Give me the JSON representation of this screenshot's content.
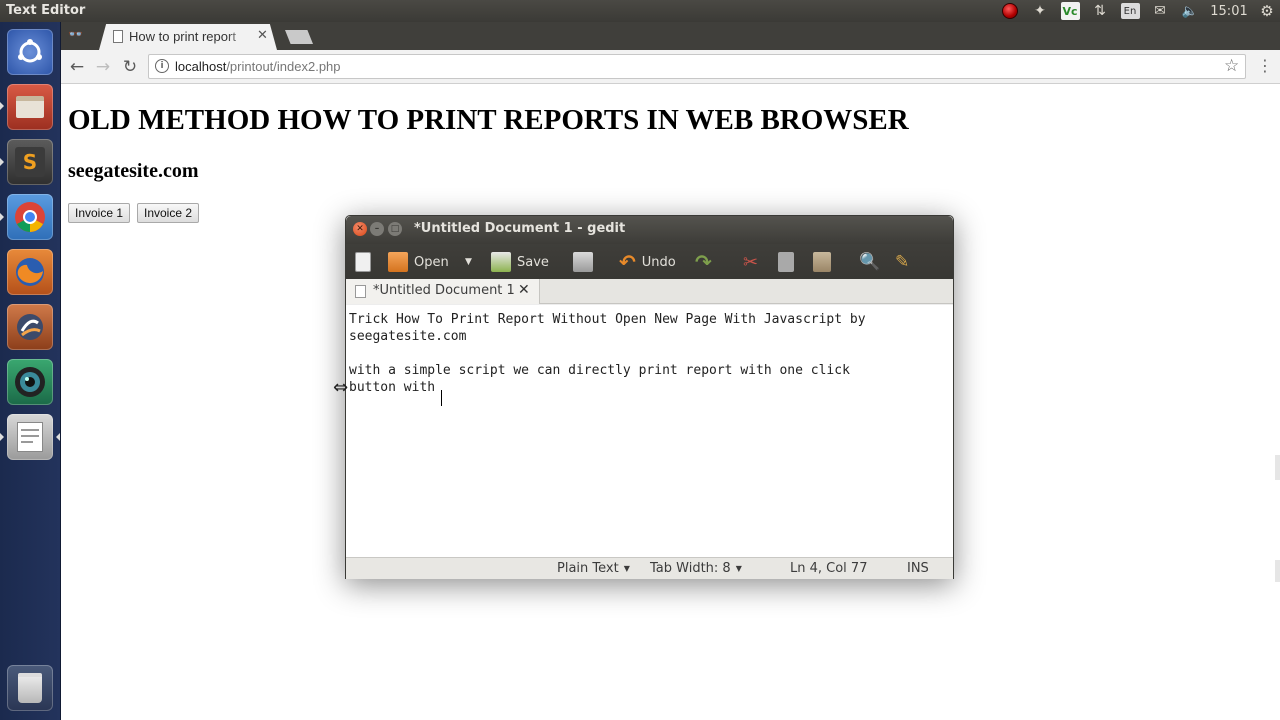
{
  "top_panel": {
    "app_title": "Text Editor",
    "clock": "15:01",
    "indicators": [
      "record-icon",
      "dropbox-icon",
      "vc-icon",
      "network-icon",
      "keyboard-layout-icon",
      "mail-icon",
      "volume-icon",
      "session-gear-icon"
    ],
    "vc_label": "Vc",
    "lang_label": "En"
  },
  "launcher": {
    "items": [
      {
        "name": "ubuntu-dash",
        "color": "#3a68c4"
      },
      {
        "name": "files",
        "color": "#c24b3a"
      },
      {
        "name": "sublime-text",
        "color": "#6b6b6b"
      },
      {
        "name": "chrome",
        "color": "#4a8ad6"
      },
      {
        "name": "firefox",
        "color": "#e8742a"
      },
      {
        "name": "system-app",
        "color": "#c86a3a"
      },
      {
        "name": "camera-app",
        "color": "#3a9a6a"
      },
      {
        "name": "text-editor",
        "color": "#b8b8b8"
      },
      {
        "name": "trash",
        "color": "#3a4a6a"
      }
    ]
  },
  "browser": {
    "tab_title": "How to print report",
    "url_host": "localhost",
    "url_path": "/printout/index2.php"
  },
  "page": {
    "heading": "OLD METHOD HOW TO PRINT REPORTS IN WEB BROWSER",
    "subheading": "seegatesite.com",
    "buttons": [
      "Invoice 1",
      "Invoice 2"
    ]
  },
  "gedit": {
    "window_title": "*Untitled Document 1 - gedit",
    "toolbar": {
      "open": "Open",
      "save": "Save",
      "undo": "Undo"
    },
    "doc_tab": "*Untitled Document 1",
    "lines": [
      "Trick How To Print Report Without Open New Page With Javascript by",
      "seegatesite.com",
      "",
      "with a simple script we can directly print report with one click",
      "button with"
    ],
    "status": {
      "language": "Plain Text",
      "tab_width": "Tab Width: 8",
      "position": "Ln 4, Col 77",
      "mode": "INS"
    }
  }
}
